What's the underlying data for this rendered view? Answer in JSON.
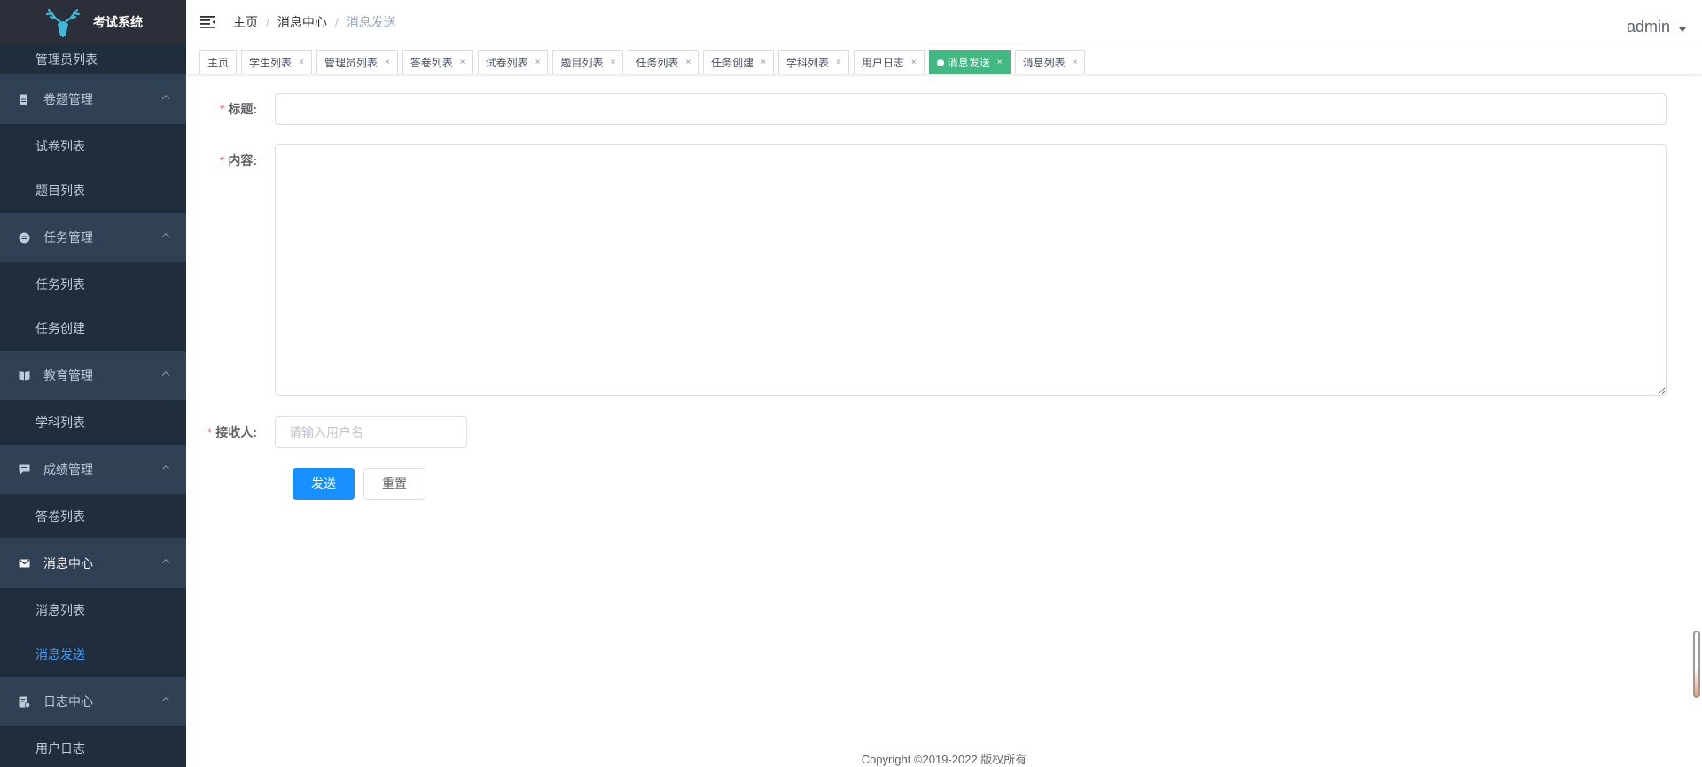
{
  "app": {
    "title": "考试系统"
  },
  "sidebar": {
    "top_item": "管理员列表",
    "groups": [
      {
        "title": "卷题管理",
        "icon": "document-icon",
        "items": [
          "试卷列表",
          "题目列表"
        ]
      },
      {
        "title": "任务管理",
        "icon": "list-circle-icon",
        "items": [
          "任务列表",
          "任务创建"
        ]
      },
      {
        "title": "教育管理",
        "icon": "book-icon",
        "items": [
          "学科列表"
        ]
      },
      {
        "title": "成绩管理",
        "icon": "chat-icon",
        "items": [
          "答卷列表"
        ]
      },
      {
        "title": "消息中心",
        "icon": "mail-icon",
        "items": [
          "消息列表",
          "消息发送"
        ]
      },
      {
        "title": "日志中心",
        "icon": "log-icon",
        "items": [
          "用户日志"
        ]
      }
    ],
    "active_item": "消息发送"
  },
  "navbar": {
    "breadcrumb": [
      "主页",
      "消息中心",
      "消息发送"
    ],
    "user": "admin"
  },
  "tags": [
    {
      "label": "主页",
      "closable": false,
      "active": false
    },
    {
      "label": "学生列表",
      "closable": true,
      "active": false
    },
    {
      "label": "管理员列表",
      "closable": true,
      "active": false
    },
    {
      "label": "答卷列表",
      "closable": true,
      "active": false
    },
    {
      "label": "试卷列表",
      "closable": true,
      "active": false
    },
    {
      "label": "题目列表",
      "closable": true,
      "active": false
    },
    {
      "label": "任务列表",
      "closable": true,
      "active": false
    },
    {
      "label": "任务创建",
      "closable": true,
      "active": false
    },
    {
      "label": "学科列表",
      "closable": true,
      "active": false
    },
    {
      "label": "用户日志",
      "closable": true,
      "active": false
    },
    {
      "label": "消息发送",
      "closable": true,
      "active": true
    },
    {
      "label": "消息列表",
      "closable": true,
      "active": false
    }
  ],
  "form": {
    "title_label": "标题:",
    "title_value": "",
    "content_label": "内容:",
    "content_value": "",
    "receiver_label": "接收人:",
    "receiver_placeholder": "请输入用户名",
    "send_button": "发送",
    "reset_button": "重置"
  },
  "footer": {
    "copyright": "Copyright ©2019-2022 版权所有"
  },
  "colors": {
    "sidebar_bg": "#304156",
    "submenu_bg": "#1f2d3d",
    "active_link": "#409eff",
    "active_tag": "#42b983",
    "primary_button": "#1890ff"
  }
}
